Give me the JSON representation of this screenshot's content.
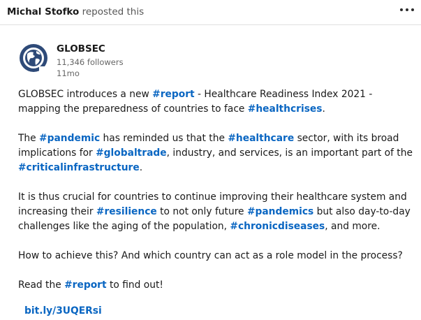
{
  "repost": {
    "author": "Michal Stofko",
    "action": "reposted this"
  },
  "more_menu": {
    "icon": "more-horizontal-icon"
  },
  "company": {
    "name": "GLOBSEC",
    "followers": "11,346 followers",
    "age": "11mo",
    "logo_icon": "globsec-globe-logo",
    "logo_color": "#2e4a78"
  },
  "colors": {
    "hashtag": "#0a66c2",
    "link": "#0a66c2",
    "text": "#191919",
    "meta": "#666666"
  },
  "post": {
    "p1": {
      "t1": "GLOBSEC introduces a new ",
      "h1": "#report",
      "t2": " - Healthcare Readiness Index 2021 - mapping the preparedness of countries to face ",
      "h2": "#healthcrises",
      "t3": "."
    },
    "p2": {
      "t1": "The ",
      "h1": "#pandemic",
      "t2": " has reminded us that the ",
      "h2": "#healthcare",
      "t3": " sector, with its broad implications for ",
      "h3": "#globaltrade",
      "t4": ", industry, and services, is an important part of the ",
      "h4": "#criticalinfrastructure",
      "t5": "."
    },
    "p3": {
      "t1": "It is thus crucial for countries to continue improving their healthcare system and increasing their ",
      "h1": "#resilience",
      "t2": " to not only future ",
      "h2": "#pandemics",
      "t3": " but also day-to-day challenges like the aging of the population, ",
      "h3": "#chronicdiseases",
      "t4": ", and more."
    },
    "p4": {
      "t1": "How to achieve this? And which country can act as a role model in the process?"
    },
    "p5": {
      "t1": "Read the ",
      "h1": "#report",
      "t2": " to find out!"
    },
    "link": "bit.ly/3UQERsi"
  }
}
